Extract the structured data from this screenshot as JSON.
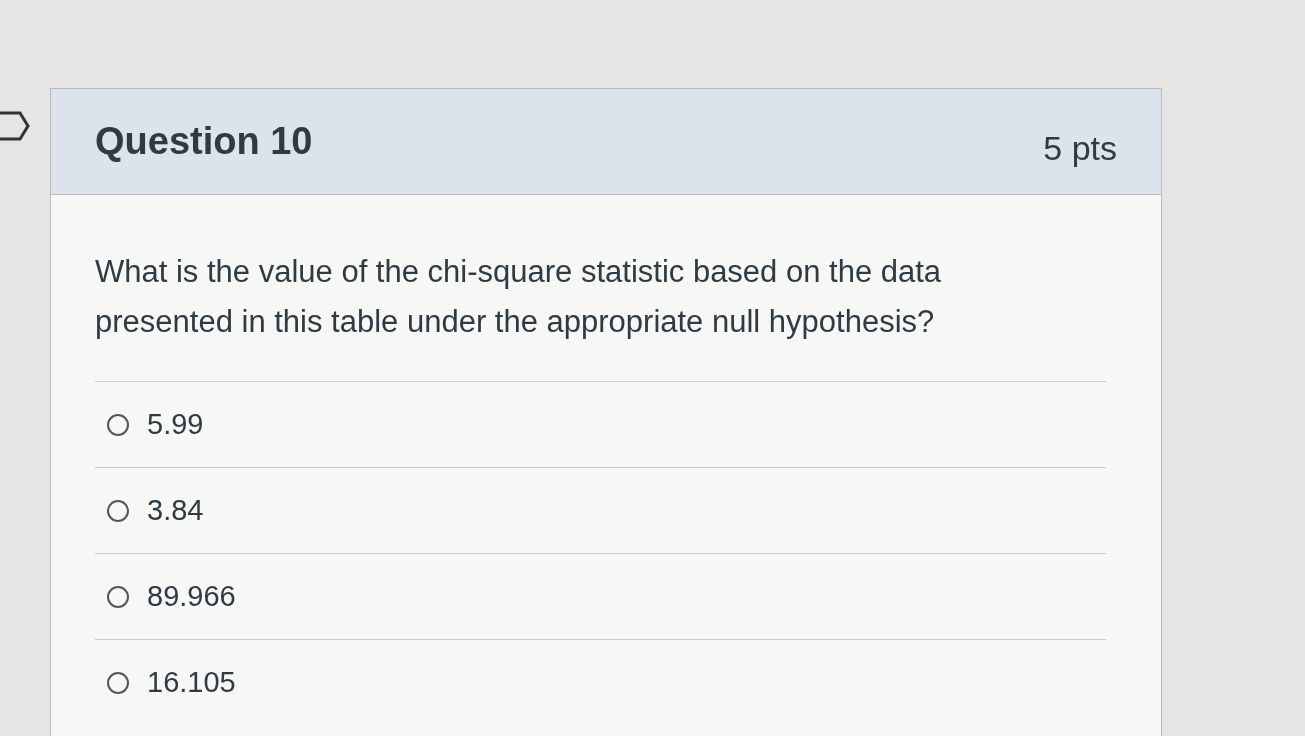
{
  "question": {
    "title": "Question 10",
    "points": "5 pts",
    "text": "What is the value of the chi-square statistic based on the data presented in this table under the appropriate null hypothesis?",
    "options": [
      {
        "label": "5.99",
        "selected": false
      },
      {
        "label": "3.84",
        "selected": false
      },
      {
        "label": "89.966",
        "selected": false
      },
      {
        "label": "16.105",
        "selected": false
      }
    ]
  }
}
